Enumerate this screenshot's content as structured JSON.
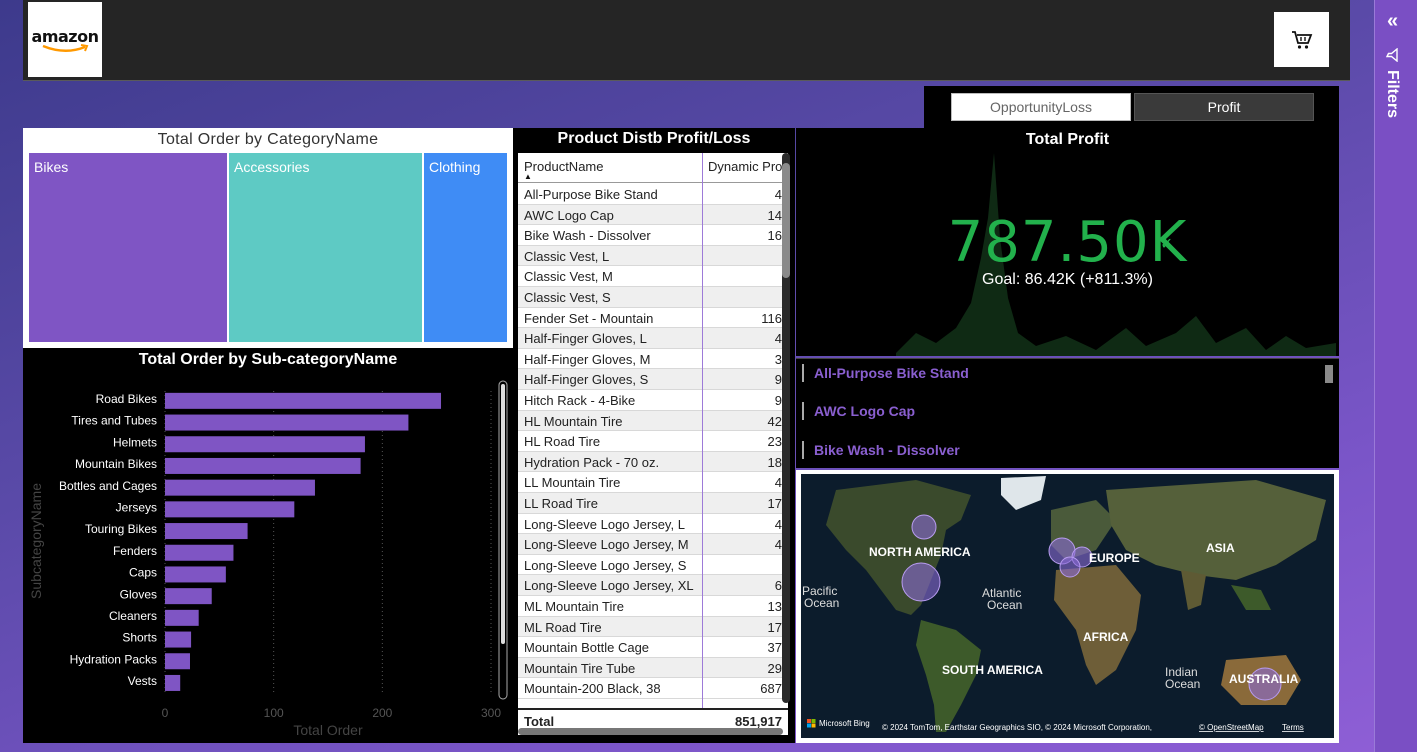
{
  "header": {
    "logo_text": "amazon",
    "cart_icon": "shopping-cart-icon"
  },
  "filters_pane": {
    "label": "Filters",
    "collapse_icon": "double-chevron-left-icon",
    "filter_icon": "funnel-icon"
  },
  "toggle": {
    "opportunity_loss": "OpportunityLoss",
    "profit": "Profit"
  },
  "treemap": {
    "title": "Total Order by CategoryName",
    "tiles": [
      {
        "label": "Bikes",
        "color": "#7f55c4"
      },
      {
        "label": "Accessories",
        "color": "#5ecac4"
      },
      {
        "label": "Clothing",
        "color": "#3f8cf5"
      }
    ]
  },
  "subcategory_chart": {
    "title": "Total Order by Sub-categoryName",
    "xlabel": "Total Order",
    "ylabel": "SubcategoryName",
    "bar_color": "#7f55c4"
  },
  "chart_data": {
    "type": "bar",
    "orientation": "horizontal",
    "title": "Total Order by Sub-categoryName",
    "xlabel": "Total Order",
    "ylabel": "SubcategoryName",
    "categories": [
      "Road Bikes",
      "Tires and Tubes",
      "Helmets",
      "Mountain Bikes",
      "Bottles and Cages",
      "Jerseys",
      "Touring Bikes",
      "Fenders",
      "Caps",
      "Gloves",
      "Cleaners",
      "Shorts",
      "Hydration Packs",
      "Vests"
    ],
    "values": [
      254,
      224,
      184,
      180,
      138,
      119,
      76,
      63,
      56,
      43,
      31,
      24,
      23,
      14
    ],
    "xlim": [
      0,
      300
    ],
    "xticks": [
      0,
      100,
      200,
      300
    ],
    "grid": true
  },
  "table": {
    "title": "Product Distb Profit/Loss",
    "columns": [
      "ProductName",
      "Dynamic Pro"
    ],
    "rows": [
      [
        "All-Purpose Bike Stand",
        "4"
      ],
      [
        "AWC Logo Cap",
        "14"
      ],
      [
        "Bike Wash - Dissolver",
        "16"
      ],
      [
        "Classic Vest, L",
        ""
      ],
      [
        "Classic Vest, M",
        ""
      ],
      [
        "Classic Vest, S",
        ""
      ],
      [
        "Fender Set - Mountain",
        "116"
      ],
      [
        "Half-Finger Gloves, L",
        "4"
      ],
      [
        "Half-Finger Gloves, M",
        "3"
      ],
      [
        "Half-Finger Gloves, S",
        "9"
      ],
      [
        "Hitch Rack - 4-Bike",
        "9"
      ],
      [
        "HL Mountain Tire",
        "42"
      ],
      [
        "HL Road Tire",
        "23"
      ],
      [
        "Hydration Pack - 70 oz.",
        "18"
      ],
      [
        "LL Mountain Tire",
        "4"
      ],
      [
        "LL Road Tire",
        "17"
      ],
      [
        "Long-Sleeve Logo Jersey, L",
        "4"
      ],
      [
        "Long-Sleeve Logo Jersey, M",
        "4"
      ],
      [
        "Long-Sleeve Logo Jersey, S",
        ""
      ],
      [
        "Long-Sleeve Logo Jersey, XL",
        "6"
      ],
      [
        "ML Mountain Tire",
        "13"
      ],
      [
        "ML Road Tire",
        "17"
      ],
      [
        "Mountain Bottle Cage",
        "37"
      ],
      [
        "Mountain Tire Tube",
        "29"
      ],
      [
        "Mountain-200 Black, 38",
        "687"
      ]
    ],
    "total_label": "Total",
    "total_value": "851,917"
  },
  "kpi": {
    "title": "Total Profit",
    "value": "787.50K",
    "goal": "Goal: 86.42K (+811.3%)",
    "value_color": "#22b14c"
  },
  "slicer": {
    "items": [
      "All-Purpose Bike Stand",
      "AWC Logo Cap",
      "Bike Wash - Dissolver"
    ]
  },
  "map": {
    "labels": {
      "north_america": "NORTH AMERICA",
      "europe": "EUROPE",
      "asia": "ASIA",
      "pacific": "Pacific",
      "pacific2": "Ocean",
      "atlantic": "Atlantic",
      "atlantic2": "Ocean",
      "africa": "AFRICA",
      "south_america": "SOUTH AMERICA",
      "indian": "Indian",
      "indian2": "Ocean",
      "australia": "AUSTRALIA"
    },
    "logo": "Microsoft Bing",
    "copyright": "© 2024 TomTom, Earthstar Geographics SIO, © 2024 Microsoft Corporation,",
    "osm_link": "© OpenStreetMap",
    "terms_link": "Terms"
  }
}
